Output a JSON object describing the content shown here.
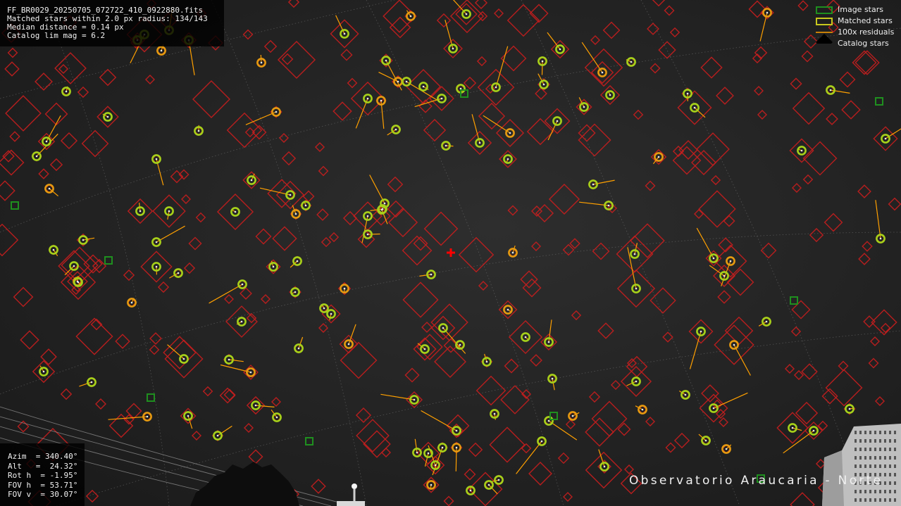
{
  "info": {
    "filename": "FF_BR0029_20250705_072722_410_0922880.fits",
    "matched": "Matched stars within 2.0 px radius: 134/143",
    "median": "Median distance = 0.14 px",
    "catalog": "Catalog lim mag = 6.2"
  },
  "pointing": {
    "azim": "Azim  = 340.40°",
    "alt": "Alt   =  24.32°",
    "roth": "Rot h  = -1.95°",
    "fovh": "FOV h  = 53.71°",
    "fovv": "FOV v  = 30.07°"
  },
  "legend": {
    "image_stars": "Image stars",
    "matched_stars": "Matched stars",
    "residuals": "100x residuals",
    "catalog_stars": "Catalog stars"
  },
  "observatory": "Observatorio Araucaria - Norte",
  "colors": {
    "catalog": "#c81e1e",
    "matched_inner": "#a6d11a",
    "matched_outer": "#e59a10",
    "image": "#1f8f1f",
    "residual": "#ffa000",
    "center_marker": "#ff0000",
    "grid": "#7a7a7a"
  }
}
